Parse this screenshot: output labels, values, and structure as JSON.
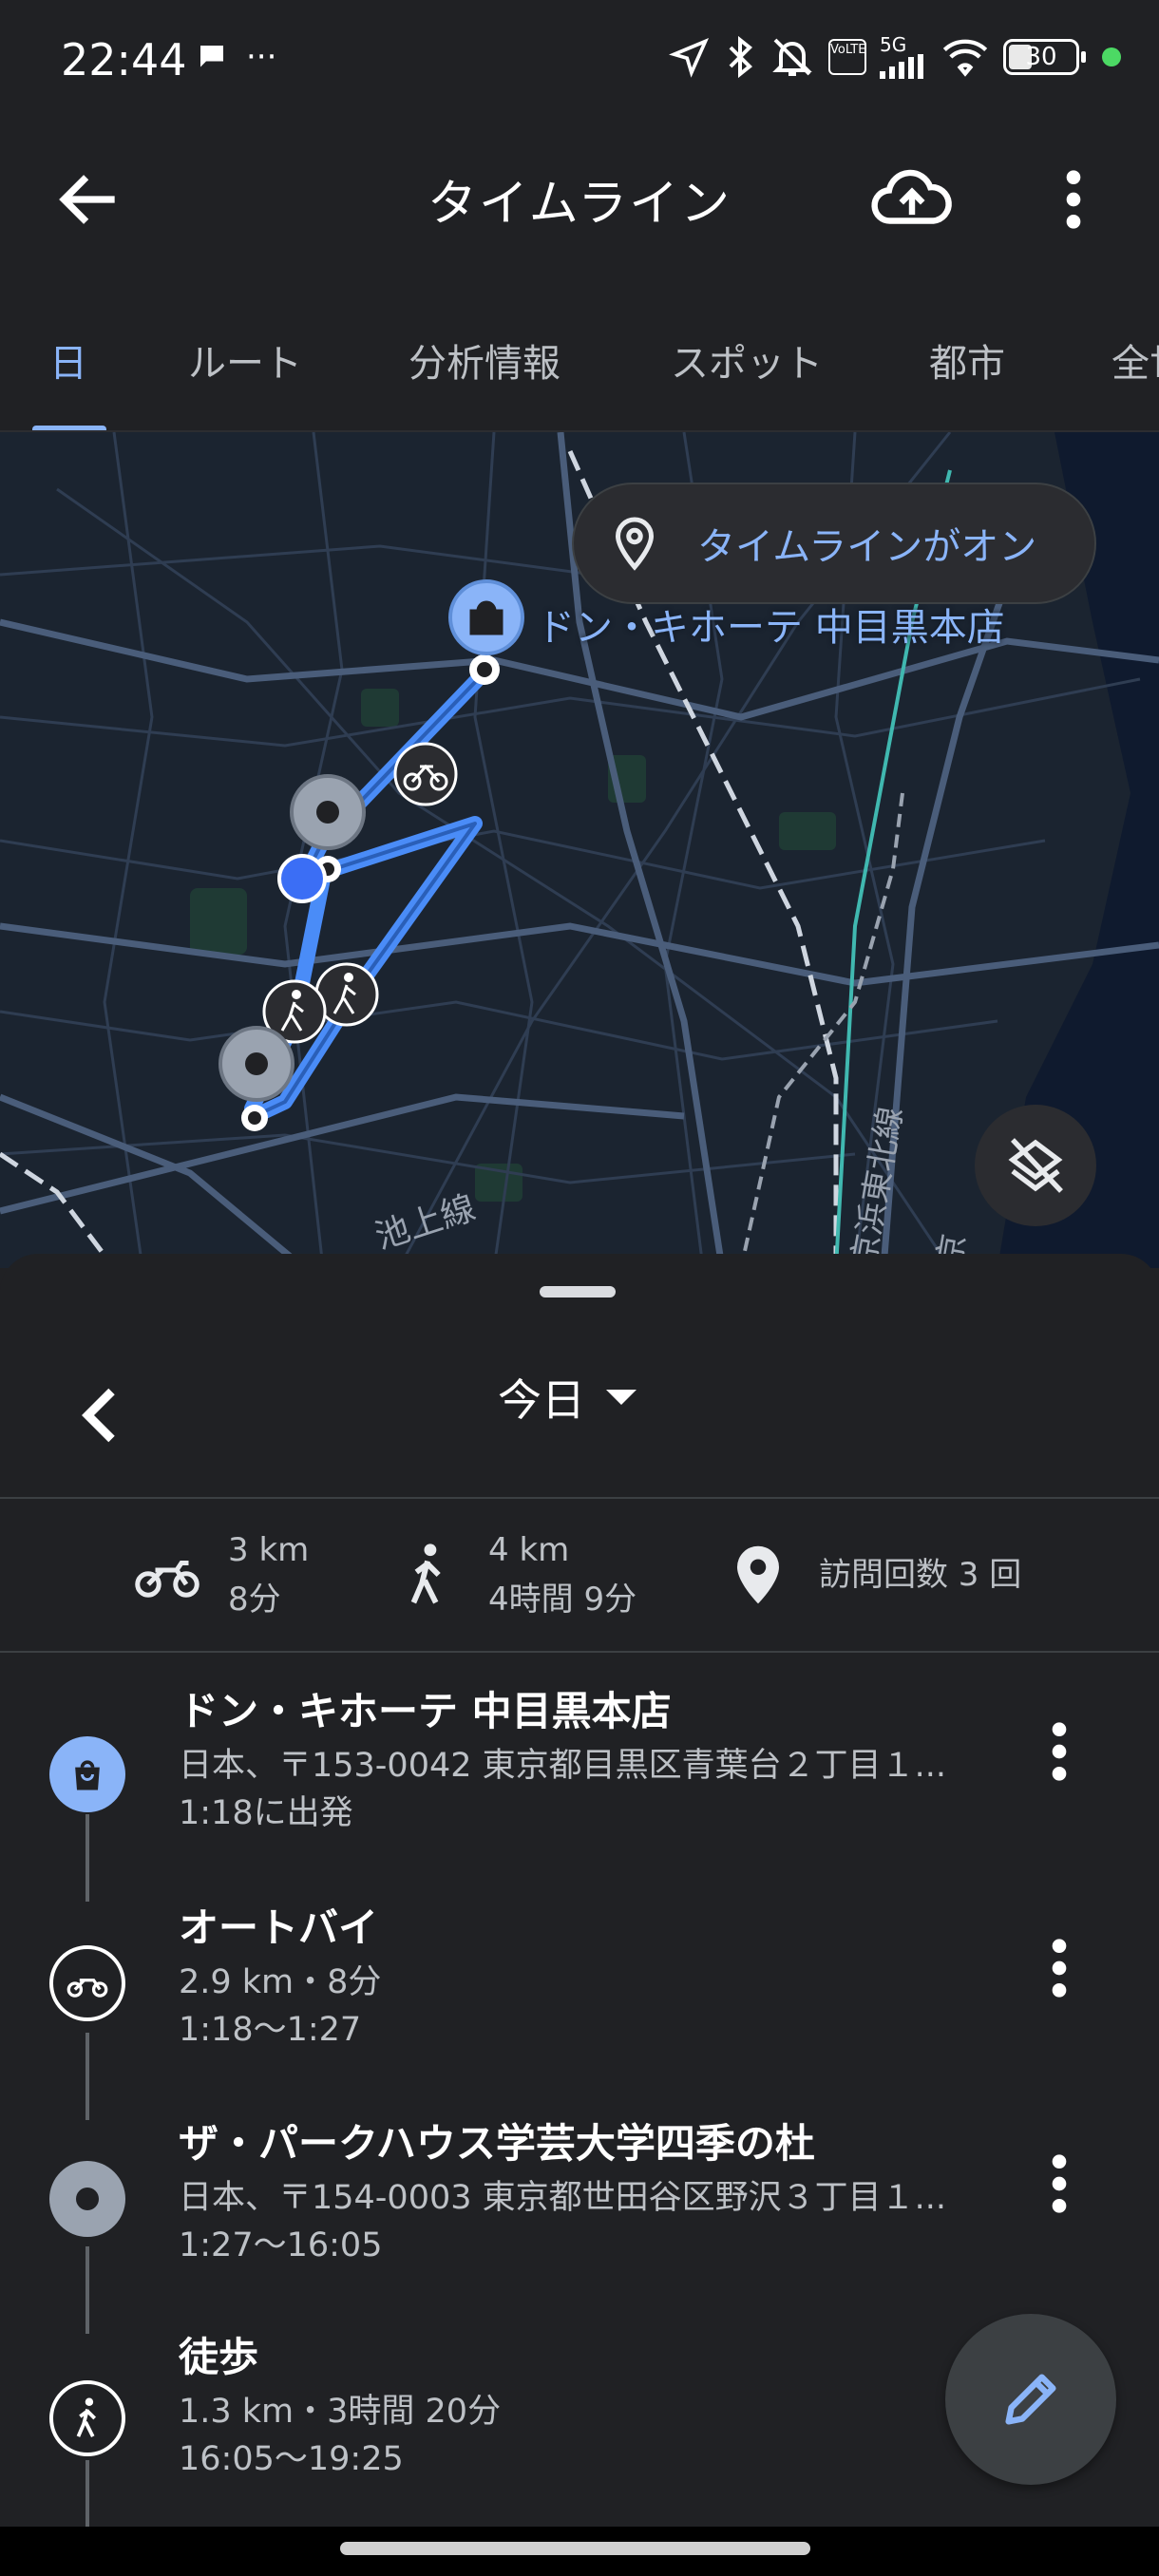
{
  "status_bar": {
    "time": "22:44",
    "extra": "···",
    "network": "5G",
    "volte": "VoLTE",
    "battery": "30",
    "colors": {
      "indicator": "#4cd964"
    }
  },
  "appbar": {
    "title": "タイムライン",
    "icons": [
      "back-arrow-icon",
      "cloud-upload-icon",
      "more-vert-icon"
    ]
  },
  "tabs": [
    {
      "label": "日",
      "active": true
    },
    {
      "label": "ルート",
      "active": false
    },
    {
      "label": "分析情報",
      "active": false
    },
    {
      "label": "スポット",
      "active": false
    },
    {
      "label": "都市",
      "active": false
    },
    {
      "label": "全世",
      "active": false
    }
  ],
  "map": {
    "pill_text": "タイムラインがオン",
    "place_label": "ドン・キホーテ 中目黒本店",
    "line_labels": [
      "池上線",
      "京浜東北線",
      "京"
    ],
    "colors": {
      "route": "#4a8cf7",
      "background": "#1b2430"
    }
  },
  "sheet": {
    "date_label": "今日",
    "stats": [
      {
        "icon": "motorcycle-icon",
        "line1": "3 km",
        "line2": "8分"
      },
      {
        "icon": "walk-icon",
        "line1": "4 km",
        "line2": "4時間 9分"
      },
      {
        "icon": "pin-icon",
        "line1": "訪問回数 3 回",
        "line2": ""
      }
    ],
    "entries": [
      {
        "icon": "shopping-bag-icon",
        "title": "ドン・キホーテ 中目黒本店",
        "sub": "日本、〒153-0042 東京都目黒区青葉台２丁目１...",
        "time": "1:18に出発"
      },
      {
        "icon": "motorcycle-icon",
        "title": "オートバイ",
        "sub": "2.9 km・8分",
        "time": "1:18～1:27"
      },
      {
        "icon": "place-dot-icon",
        "title": "ザ・パークハウス学芸大学四季の杜",
        "sub": "日本、〒154-0003 東京都世田谷区野沢３丁目１...",
        "time": "1:27～16:05"
      },
      {
        "icon": "walk-icon",
        "title": "徒歩",
        "sub": "1.3 km・3時間 20分",
        "time": "16:05～19:25"
      }
    ]
  },
  "fab": {
    "icon": "edit-pencil-icon"
  }
}
